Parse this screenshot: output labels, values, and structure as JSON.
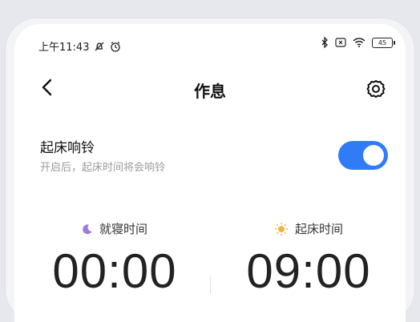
{
  "status": {
    "time": "上午11:43",
    "battery": "45",
    "icons": [
      "mute-bell-icon",
      "alarm-clock-icon",
      "bluetooth-icon",
      "sim-x-icon",
      "wifi-icon",
      "battery-icon"
    ]
  },
  "header": {
    "title": "作息",
    "back_icon": "back-chevron-icon",
    "settings_icon": "gear-icon"
  },
  "alarm": {
    "title": "起床响铃",
    "subtitle": "开启后，起床时间将会响铃",
    "enabled": true
  },
  "schedule": {
    "bedtime_label": "就寝时间",
    "bedtime": "00:00",
    "bedtime_icon": "moon-icon",
    "wake_label": "起床时间",
    "wake": "09:00",
    "wake_icon": "sun-icon"
  },
  "colors": {
    "accent": "#2f7cf6",
    "moon": "#9a7be6",
    "sun": "#f6b53a"
  }
}
